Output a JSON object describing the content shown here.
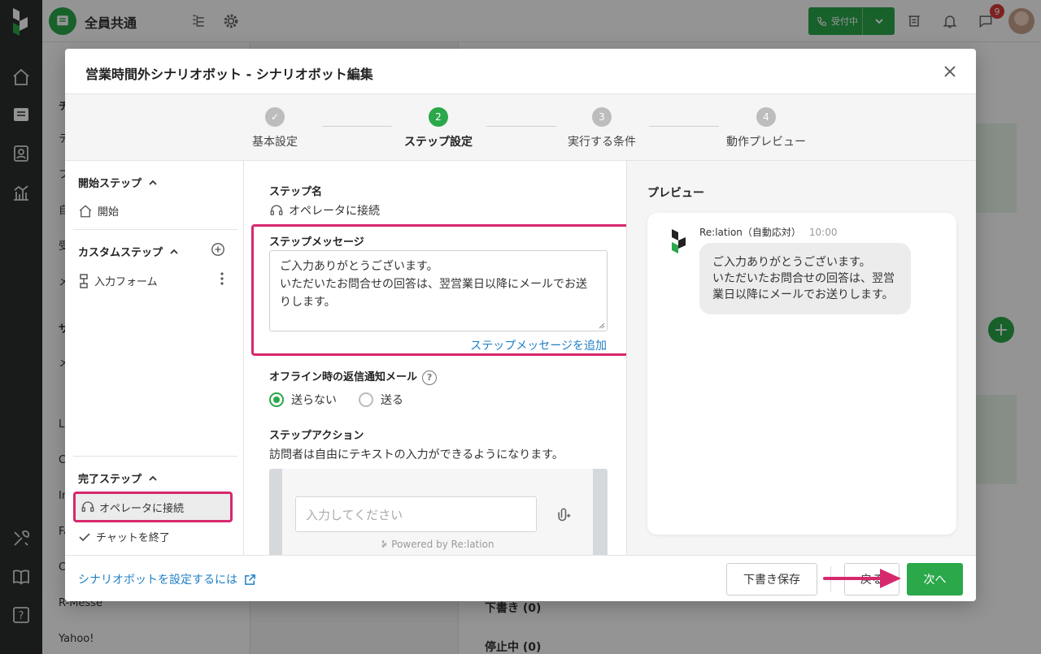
{
  "app": {
    "inbox_name": "全員共通",
    "status_label": "受付中",
    "notification_count": "9",
    "sidebar_visible_items": [
      "チ",
      "テ",
      "フ",
      "自",
      "受",
      "メ",
      "サ",
      "メ",
      "L",
      "C",
      "In",
      "Fa",
      "C",
      "R-Messe",
      "Yahoo!"
    ],
    "main_sections": [
      "下書き (0)",
      "停止中 (0)"
    ]
  },
  "modal": {
    "title": "営業時間外シナリオボット - シナリオボット編集",
    "steps": [
      {
        "number": "✓",
        "label": "基本設定",
        "state": "done"
      },
      {
        "number": "2",
        "label": "ステップ設定",
        "state": "active"
      },
      {
        "number": "3",
        "label": "実行する条件",
        "state": "todo"
      },
      {
        "number": "4",
        "label": "動作プレビュー",
        "state": "todo"
      }
    ],
    "tree": {
      "start_section": "開始ステップ",
      "start_item": "開始",
      "custom_section": "カスタムステップ",
      "custom_item": "入力フォーム",
      "end_section": "完了ステップ",
      "end_item_selected": "オペレータに接続",
      "end_item_other": "チャットを終了"
    },
    "editor": {
      "step_name_label": "ステップ名",
      "step_name_value": "オペレータに接続",
      "message_label": "ステップメッセージ",
      "message_line1": "ご入力ありがとうございます。",
      "message_line2": "いただいたお問合せの回答は、翌営業日以降にメールでお送",
      "message_line3": "りします。",
      "add_message_link": "ステップメッセージを追加",
      "offline_mail_label": "オフライン時の返信通知メール",
      "radio_no": "送らない",
      "radio_yes": "送る",
      "radio_selected": "送らない",
      "action_label": "ステップアクション",
      "action_desc": "訪問者は自由にテキストの入力ができるようになります。",
      "input_placeholder": "入力してください",
      "powered_by": "Powered by Re:lation"
    },
    "preview": {
      "title": "プレビュー",
      "bot_name": "Re:lation（自動応対）",
      "time": "10:00",
      "bubble_line1": "ご入力ありがとうございます。",
      "bubble_line2": "いただいたお問合せの回答は、翌営",
      "bubble_line3": "業日以降にメールでお送りします。"
    },
    "footer": {
      "help_link": "シナリオボットを設定するには",
      "save_draft": "下書き保存",
      "back": "戻る",
      "next": "次へ"
    }
  },
  "colors": {
    "brand_green": "#2aa84a",
    "highlight_pink": "#d6286d",
    "link_blue": "#1f7fc6"
  }
}
